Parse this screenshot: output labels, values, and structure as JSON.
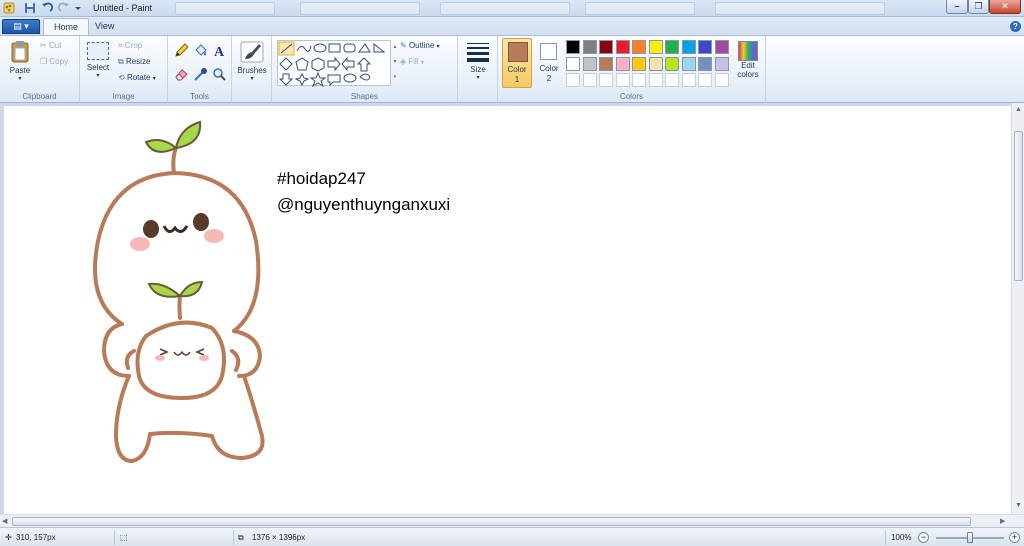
{
  "window": {
    "title": "Untitled - Paint",
    "minimize_glyph": "–",
    "maximize_glyph": "❐",
    "close_glyph": "✕"
  },
  "tabs": {
    "file_glyph": "▤ ▾",
    "home": "Home",
    "view": "View",
    "help_glyph": "?"
  },
  "ribbon": {
    "clipboard": {
      "label": "Clipboard",
      "paste": "Paste",
      "cut": "Cut",
      "copy": "Copy"
    },
    "image": {
      "label": "Image",
      "select": "Select",
      "crop": "Crop",
      "resize": "Resize",
      "rotate": "Rotate"
    },
    "tools": {
      "label": "Tools"
    },
    "brushes": {
      "label": "Brushes"
    },
    "shapes": {
      "label": "Shapes",
      "outline": "Outline",
      "fill": "Fill"
    },
    "size": {
      "label": "Size"
    },
    "colors": {
      "label": "Colors",
      "color1": "Color",
      "color1_num": "1",
      "color2": "Color",
      "color2_num": "2",
      "edit_colors_line1": "Edit",
      "edit_colors_line2": "colors",
      "color1_value": "#b97a57",
      "color2_value": "#ffffff",
      "palette_row1": [
        "#000000",
        "#7f7f7f",
        "#880015",
        "#ed1c24",
        "#ff7f27",
        "#fff200",
        "#22b14c",
        "#00a2e8",
        "#3f48cc",
        "#a349a4"
      ],
      "palette_row2": [
        "#ffffff",
        "#c3c3c3",
        "#b97a57",
        "#ffaec9",
        "#ffc90e",
        "#efe4b0",
        "#b5e61d",
        "#99d9ea",
        "#7092be",
        "#c8bfe7"
      ]
    }
  },
  "canvas": {
    "text_line1": "#hoidap247",
    "text_line2": "@nguyenthuynganxuxi"
  },
  "status": {
    "cursor_pos": "310, 157px",
    "image_size": "1376 × 1396px",
    "zoom": "100%",
    "zoom_level": 0.5
  }
}
